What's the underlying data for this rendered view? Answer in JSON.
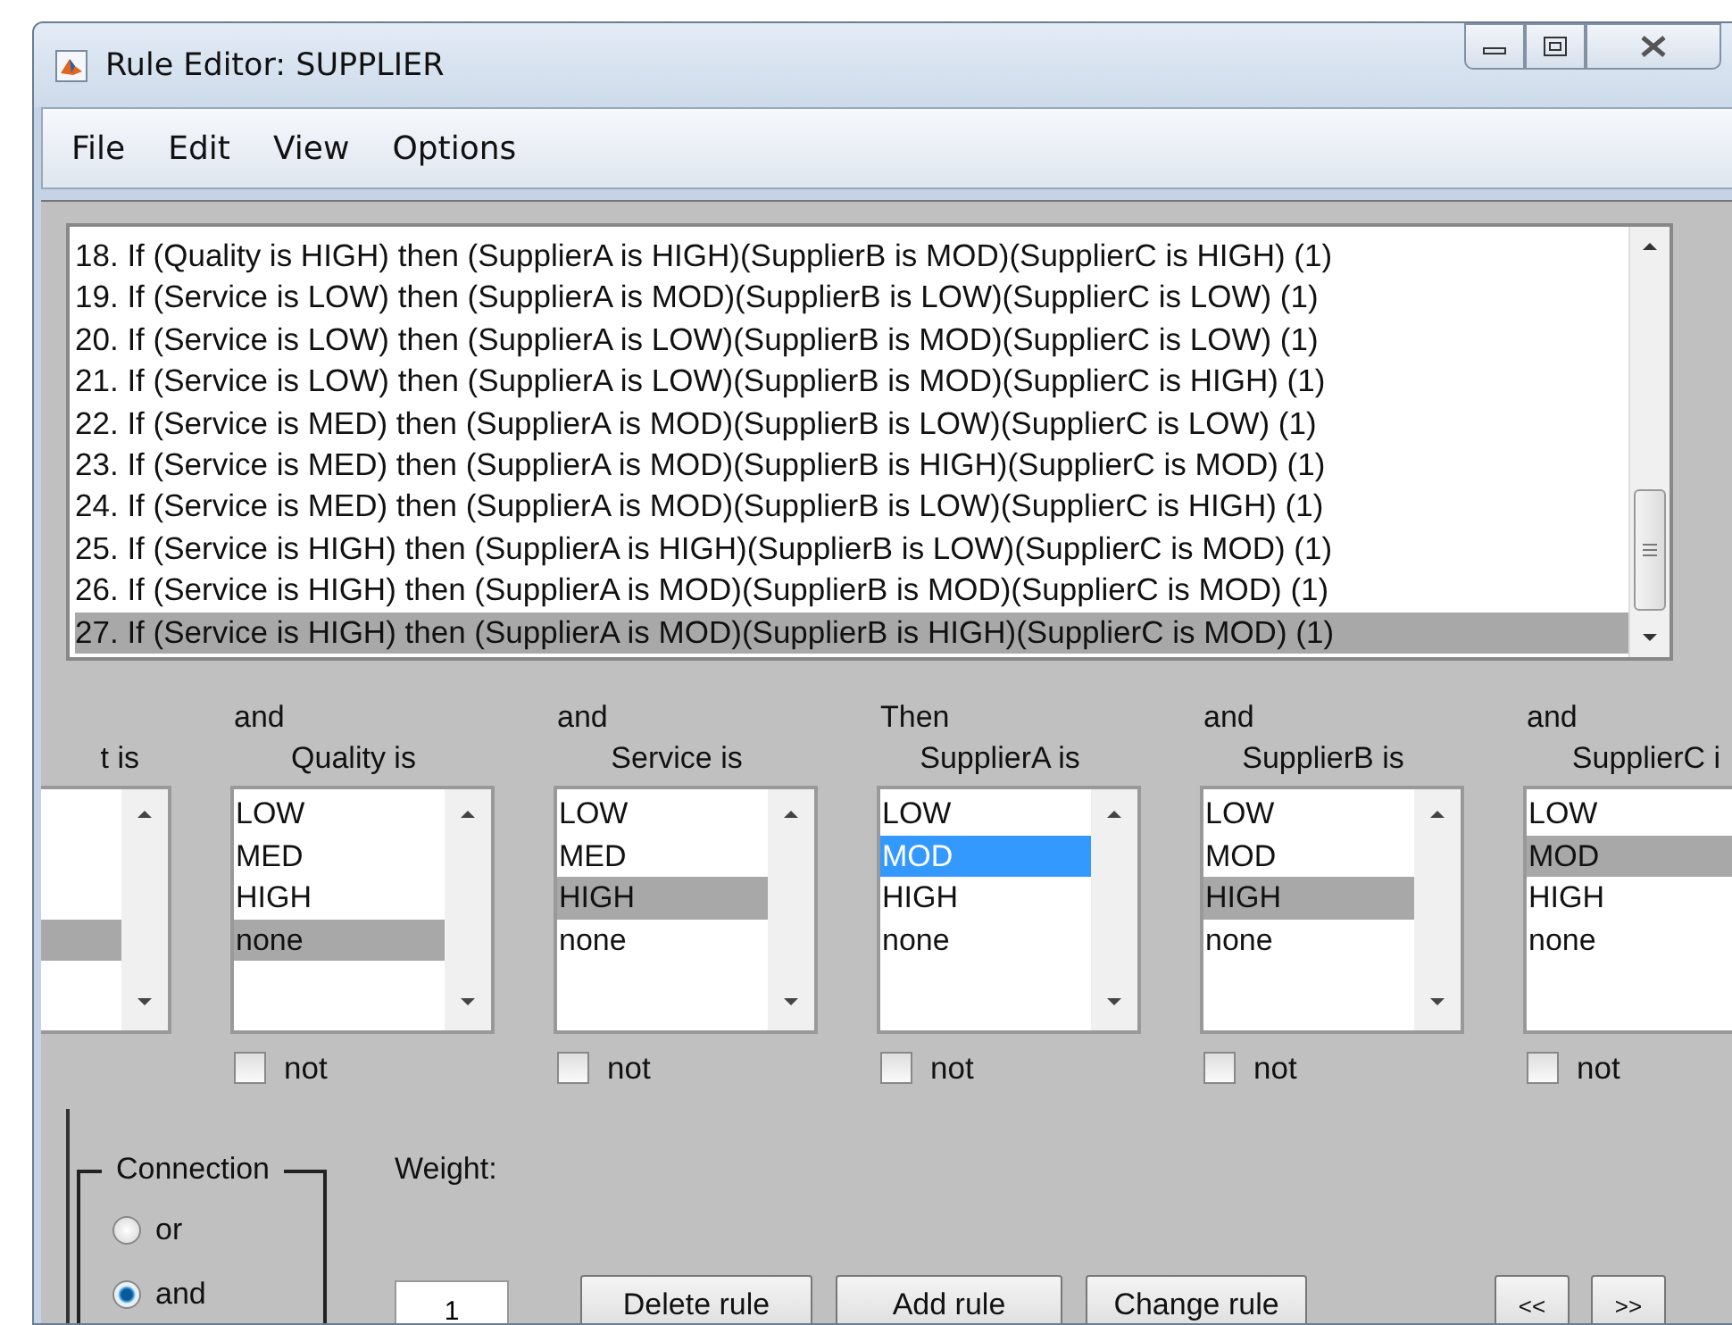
{
  "window": {
    "title": "Rule Editor: SUPPLIER"
  },
  "menu": [
    "File",
    "Edit",
    "View",
    "Options"
  ],
  "rules": [
    {
      "text": "18. If (Quality is HIGH) then (SupplierA is HIGH)(SupplierB is MOD)(SupplierC is HIGH) (1)",
      "selected": false
    },
    {
      "text": "19. If (Service is LOW) then (SupplierA is MOD)(SupplierB is LOW)(SupplierC is LOW) (1)",
      "selected": false
    },
    {
      "text": "20. If (Service is LOW) then (SupplierA is LOW)(SupplierB is MOD)(SupplierC is LOW) (1)",
      "selected": false
    },
    {
      "text": "21. If (Service is LOW) then (SupplierA is LOW)(SupplierB is MOD)(SupplierC is HIGH) (1)",
      "selected": false
    },
    {
      "text": "22. If (Service is MED) then (SupplierA is MOD)(SupplierB is LOW)(SupplierC is LOW) (1)",
      "selected": false
    },
    {
      "text": "23. If (Service is MED) then (SupplierA is MOD)(SupplierB is HIGH)(SupplierC is MOD) (1)",
      "selected": false
    },
    {
      "text": "24. If (Service is MED) then (SupplierA is MOD)(SupplierB is LOW)(SupplierC is HIGH) (1)",
      "selected": false
    },
    {
      "text": "25. If (Service is HIGH) then (SupplierA is HIGH)(SupplierB is LOW)(SupplierC is MOD) (1)",
      "selected": false
    },
    {
      "text": "26. If (Service is HIGH) then (SupplierA is MOD)(SupplierB is MOD)(SupplierC is MOD) (1)",
      "selected": false
    },
    {
      "text": "27. If (Service is HIGH) then (SupplierA is MOD)(SupplierB is HIGH)(SupplierC is MOD) (1)",
      "selected": true
    }
  ],
  "columns": [
    {
      "label": "t is",
      "items": [
        {
          "selected": false
        },
        {
          "selected": false
        },
        {
          "selected": false
        },
        {
          "selected": true
        }
      ]
    },
    {
      "connective": "and",
      "label": "Quality is",
      "items": [
        {
          "label": "LOW",
          "selected": false
        },
        {
          "label": "MED",
          "selected": false
        },
        {
          "label": "HIGH",
          "selected": false
        },
        {
          "label": "none",
          "selected": true
        }
      ],
      "not": {
        "label": "not",
        "checked": false
      }
    },
    {
      "connective": "and",
      "label": "Service is",
      "items": [
        {
          "label": "LOW",
          "selected": false
        },
        {
          "label": "MED",
          "selected": false
        },
        {
          "label": "HIGH",
          "selected": true
        },
        {
          "label": "none",
          "selected": false
        }
      ],
      "not": {
        "label": "not",
        "checked": false
      }
    },
    {
      "connective": "Then",
      "label": "SupplierA is",
      "focused": true,
      "items": [
        {
          "label": "LOW",
          "selected": false
        },
        {
          "label": "MOD",
          "selected": true
        },
        {
          "label": "HIGH",
          "selected": false
        },
        {
          "label": "none",
          "selected": false
        }
      ],
      "not": {
        "label": "not",
        "checked": false
      }
    },
    {
      "connective": "and",
      "label": "SupplierB is",
      "items": [
        {
          "label": "LOW",
          "selected": false
        },
        {
          "label": "MOD",
          "selected": false
        },
        {
          "label": "HIGH",
          "selected": true
        },
        {
          "label": "none",
          "selected": false
        }
      ],
      "not": {
        "label": "not",
        "checked": false
      }
    },
    {
      "connective": "and",
      "label": "SupplierC i",
      "items": [
        {
          "label": "LOW",
          "selected": false
        },
        {
          "label": "MOD",
          "selected": true
        },
        {
          "label": "HIGH",
          "selected": false
        },
        {
          "label": "none",
          "selected": false
        }
      ],
      "not": {
        "label": "not",
        "checked": false
      }
    }
  ],
  "connection": {
    "title": "Connection",
    "options": [
      {
        "label": "or",
        "selected": false
      },
      {
        "label": "and",
        "selected": true
      }
    ]
  },
  "weight": {
    "label": "Weight:",
    "value": "1"
  },
  "buttons": [
    "Delete rule",
    "Add rule",
    "Change rule"
  ],
  "nav_buttons": [
    "<<",
    ">>"
  ]
}
